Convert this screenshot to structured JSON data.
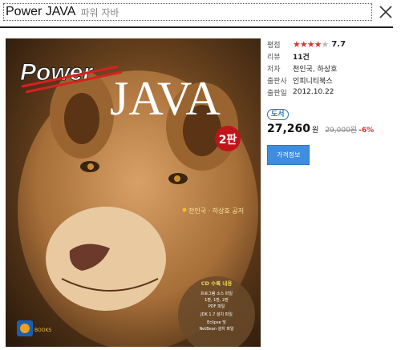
{
  "header": {
    "title": "Power JAVA",
    "subtitle": "파워 자바"
  },
  "cover": {
    "brand": "Power",
    "title": "JAVA",
    "edition": "2판",
    "authors": "천인국 · 하상호 공저",
    "cd_title": "CD 수록 내용",
    "cd_lines": [
      "프로그램 소스 파일",
      "1판, 1판, 2판",
      "PDF 파일",
      "JDK 1.7 설치 파일",
      "Eclipse 및",
      "NetBean 설치 파일"
    ],
    "publisher_logo": "BOOKS"
  },
  "info": {
    "rating_label": "평점",
    "rating_stars": 4,
    "rating_value": "7.7",
    "review_label": "리뷰",
    "review_value": "11건",
    "author_label": "저자",
    "author_value": "천인국, 하상호",
    "publisher_label": "출판사",
    "publisher_value": "인피니티북스",
    "date_label": "출판일",
    "date_value": "2012.10.22",
    "badge": "도서",
    "price": "27,260",
    "price_unit": "원",
    "original_price": "29,000원",
    "discount": "-6%",
    "price_button": "가격정보"
  },
  "colors": {
    "accent": "#3f8de0",
    "star": "#e03030",
    "discount": "#e03030"
  }
}
